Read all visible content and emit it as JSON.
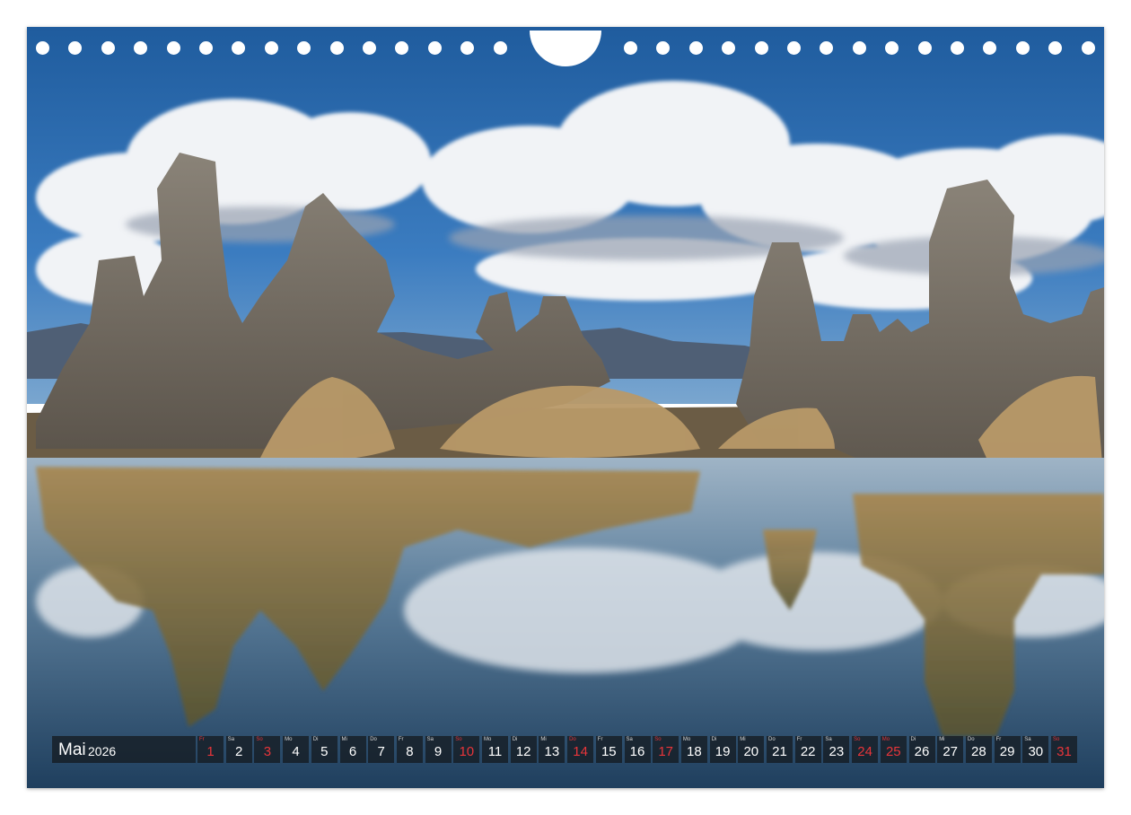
{
  "photo": {
    "subject": "tufa-towers-lake-reflection"
  },
  "calendar": {
    "month": "Mai",
    "year": "2026",
    "accent_color": "#e8353a",
    "days": [
      {
        "dn": "Fr",
        "num": "1",
        "red": true
      },
      {
        "dn": "Sa",
        "num": "2",
        "red": false
      },
      {
        "dn": "So",
        "num": "3",
        "red": true
      },
      {
        "dn": "Mo",
        "num": "4",
        "red": false
      },
      {
        "dn": "Di",
        "num": "5",
        "red": false
      },
      {
        "dn": "Mi",
        "num": "6",
        "red": false
      },
      {
        "dn": "Do",
        "num": "7",
        "red": false
      },
      {
        "dn": "Fr",
        "num": "8",
        "red": false
      },
      {
        "dn": "Sa",
        "num": "9",
        "red": false
      },
      {
        "dn": "So",
        "num": "10",
        "red": true
      },
      {
        "dn": "Mo",
        "num": "11",
        "red": false
      },
      {
        "dn": "Di",
        "num": "12",
        "red": false
      },
      {
        "dn": "Mi",
        "num": "13",
        "red": false
      },
      {
        "dn": "Do",
        "num": "14",
        "red": true
      },
      {
        "dn": "Fr",
        "num": "15",
        "red": false
      },
      {
        "dn": "Sa",
        "num": "16",
        "red": false
      },
      {
        "dn": "So",
        "num": "17",
        "red": true
      },
      {
        "dn": "Mo",
        "num": "18",
        "red": false
      },
      {
        "dn": "Di",
        "num": "19",
        "red": false
      },
      {
        "dn": "Mi",
        "num": "20",
        "red": false
      },
      {
        "dn": "Do",
        "num": "21",
        "red": false
      },
      {
        "dn": "Fr",
        "num": "22",
        "red": false
      },
      {
        "dn": "Sa",
        "num": "23",
        "red": false
      },
      {
        "dn": "So",
        "num": "24",
        "red": true
      },
      {
        "dn": "Mo",
        "num": "25",
        "red": true
      },
      {
        "dn": "Di",
        "num": "26",
        "red": false
      },
      {
        "dn": "Mi",
        "num": "27",
        "red": false
      },
      {
        "dn": "Do",
        "num": "28",
        "red": false
      },
      {
        "dn": "Fr",
        "num": "29",
        "red": false
      },
      {
        "dn": "Sa",
        "num": "30",
        "red": false
      },
      {
        "dn": "So",
        "num": "31",
        "red": true
      }
    ]
  }
}
